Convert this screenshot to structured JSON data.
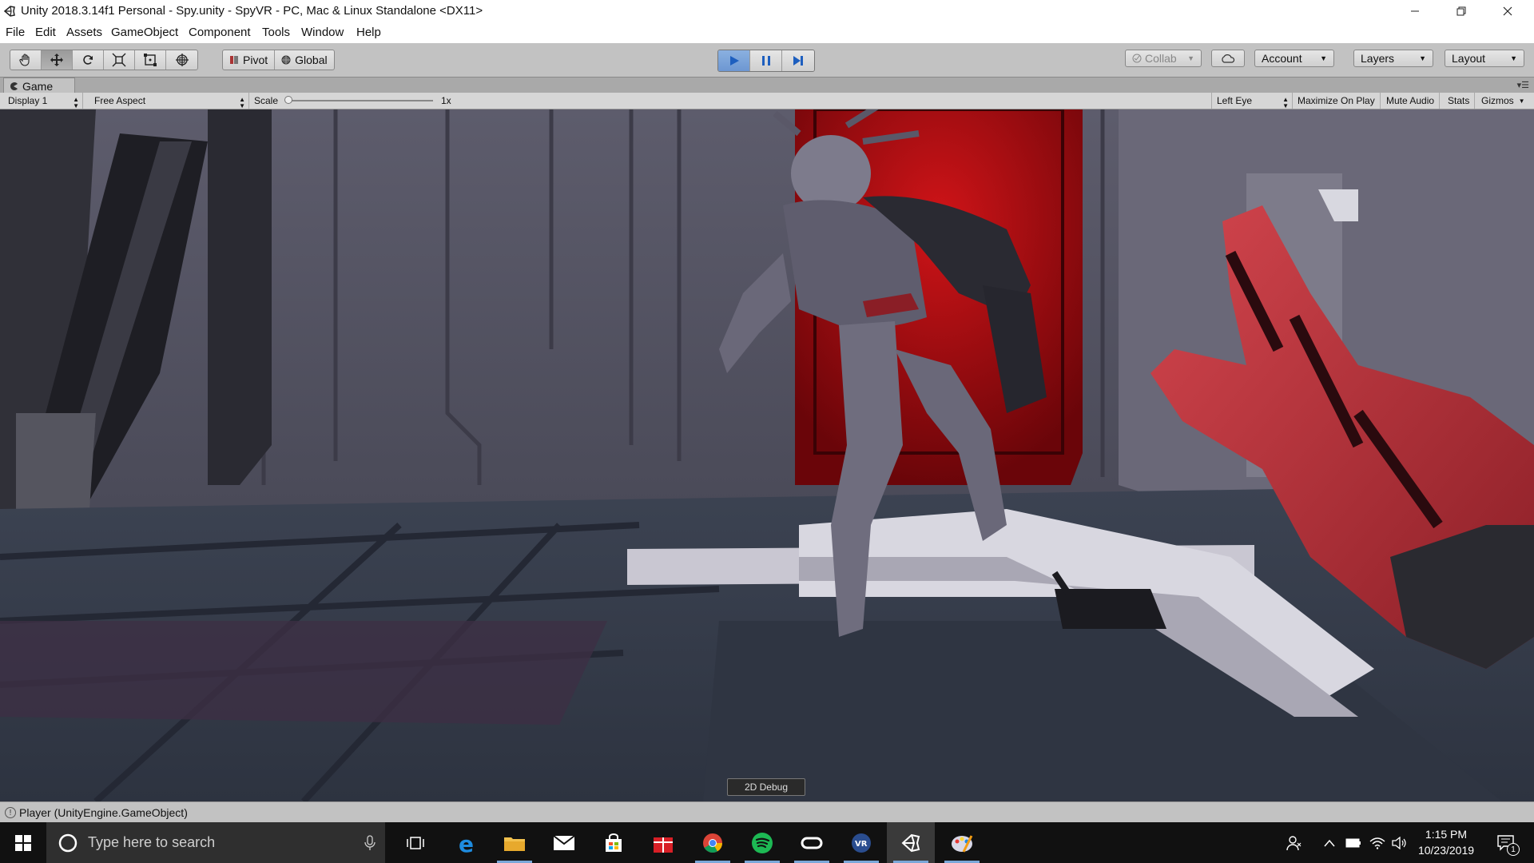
{
  "window": {
    "title": "Unity 2018.3.14f1 Personal - Spy.unity - SpyVR - PC, Mac & Linux Standalone <DX11>"
  },
  "menu": [
    "File",
    "Edit",
    "Assets",
    "GameObject",
    "Component",
    "Tools",
    "Window",
    "Help"
  ],
  "toolbar": {
    "tools": [
      "hand-tool",
      "move-tool",
      "rotate-tool",
      "scale-tool",
      "rect-tool",
      "transform-tool"
    ],
    "pivot_label": "Pivot",
    "global_label": "Global",
    "play_state": "playing",
    "collab_label": "Collab",
    "account_label": "Account",
    "layers_label": "Layers",
    "layout_label": "Layout"
  },
  "game_tab": {
    "label": "Game"
  },
  "game_toolbar": {
    "display": "Display 1",
    "aspect": "Free Aspect",
    "scale_label": "Scale",
    "scale_value": "1x",
    "eye": "Left Eye",
    "maximize": "Maximize On Play",
    "mute": "Mute Audio",
    "stats": "Stats",
    "gizmos": "Gizmos"
  },
  "viewport": {
    "debug_button": "2D Debug"
  },
  "status": {
    "message": "Player (UnityEngine.GameObject)"
  },
  "taskbar": {
    "search_placeholder": "Type here to search",
    "time": "1:15 PM",
    "date": "10/23/2019",
    "notification_count": "1",
    "apps": [
      "task-view",
      "edge",
      "file-explorer",
      "mail",
      "store",
      "gift",
      "chrome",
      "spotify",
      "oculus",
      "vr",
      "unity",
      "paint"
    ]
  },
  "colors": {
    "unity_toolbar": "#c2c2c2",
    "play_active": "#6d97d2",
    "taskbar": "#111111",
    "door_red": "#a00a10",
    "glove_red": "#b8323a"
  }
}
